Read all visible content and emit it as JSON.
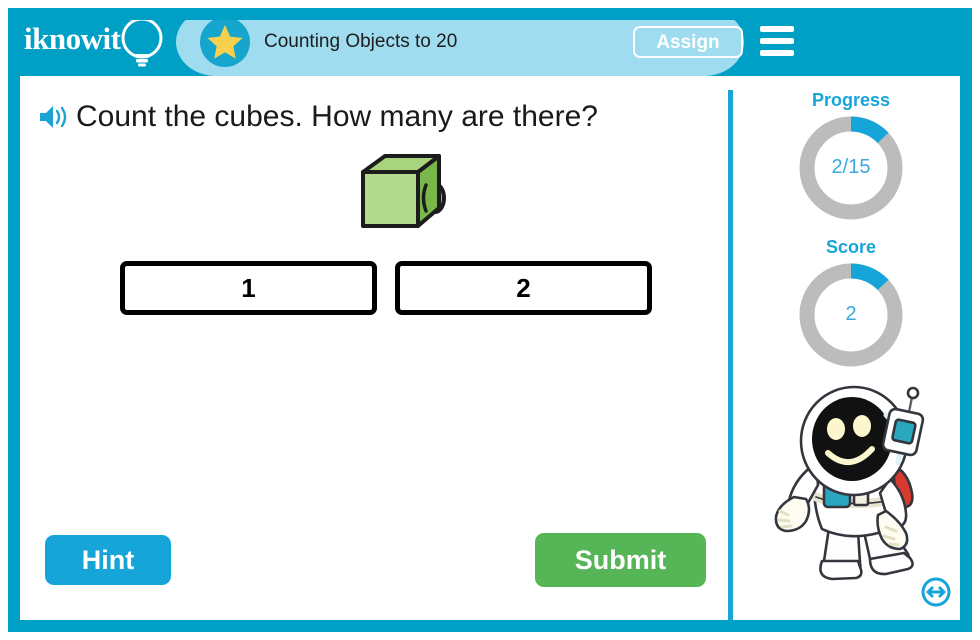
{
  "app": {
    "logo_text": "iknowit",
    "logo_icon": "lightbulb-icon"
  },
  "header": {
    "lesson_title": "Counting Objects to 20",
    "star_icon": "star-icon",
    "assign_label": "Assign",
    "menu_icon": "hamburger-menu-icon",
    "background_color": "#00a0c6",
    "tab_color": "#9fdcef"
  },
  "question": {
    "speaker_icon": "speaker-audio-icon",
    "text": "Count the cubes. How many are there?"
  },
  "illustration": {
    "object_name": "green-snap-cube",
    "count": 1,
    "face_color": "#a8d47e",
    "top_color": "#a8d47e",
    "side_color": "#78b84b",
    "outline_color": "#1c1c1c"
  },
  "answers": {
    "options": [
      {
        "label": "1",
        "selected": false
      },
      {
        "label": "2",
        "selected": false
      }
    ]
  },
  "actions": {
    "hint_label": "Hint",
    "hint_color": "#16a5d8",
    "submit_label": "Submit",
    "submit_color": "#56b657"
  },
  "sidebar": {
    "progress": {
      "label": "Progress",
      "value_text": "2/15",
      "current": 2,
      "total": 15,
      "percent": 13,
      "arc_color": "#16a5d8",
      "track_color": "#bcbcbc"
    },
    "score": {
      "label": "Score",
      "value_text": "2",
      "current": 2,
      "percent": 13,
      "arc_color": "#16a5d8",
      "track_color": "#bcbcbc"
    },
    "mascot": {
      "name": "astronaut-mascot",
      "visor_color": "#111111",
      "accent_color": "#2aa7bf",
      "pack_color": "#d73b30"
    },
    "resize_icon": "resize-horizontal-icon"
  }
}
